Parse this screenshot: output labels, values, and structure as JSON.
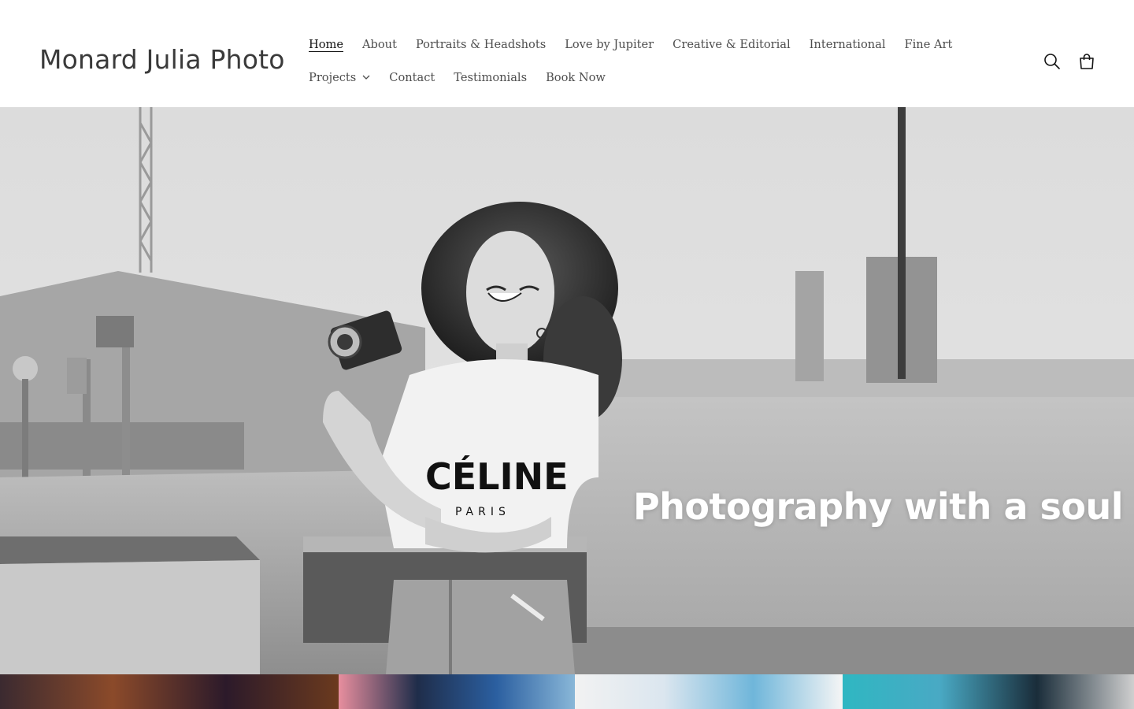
{
  "header": {
    "logo": "Monard Julia Photo",
    "nav": [
      {
        "label": "Home",
        "active": true
      },
      {
        "label": "About"
      },
      {
        "label": "Portraits & Headshots"
      },
      {
        "label": "Love by Jupiter"
      },
      {
        "label": "Creative & Editorial"
      },
      {
        "label": "International"
      },
      {
        "label": "Fine Art"
      },
      {
        "label": "Projects",
        "has_dropdown": true
      },
      {
        "label": "Contact"
      },
      {
        "label": "Testimonials"
      },
      {
        "label": "Book Now"
      }
    ],
    "icons": [
      "search-icon",
      "cart-icon"
    ]
  },
  "hero": {
    "heading": "Photography with a soul",
    "image": "black-and-white photo of smiling woman holding a vintage camera on a rooftop",
    "shirt_print": "CÉLINE",
    "shirt_subprint": "PARIS"
  },
  "colors": {
    "text": "#121212",
    "nav_text": "#4d4d4d",
    "logo": "#3a3a3a",
    "hero_heading": "#ffffff"
  }
}
